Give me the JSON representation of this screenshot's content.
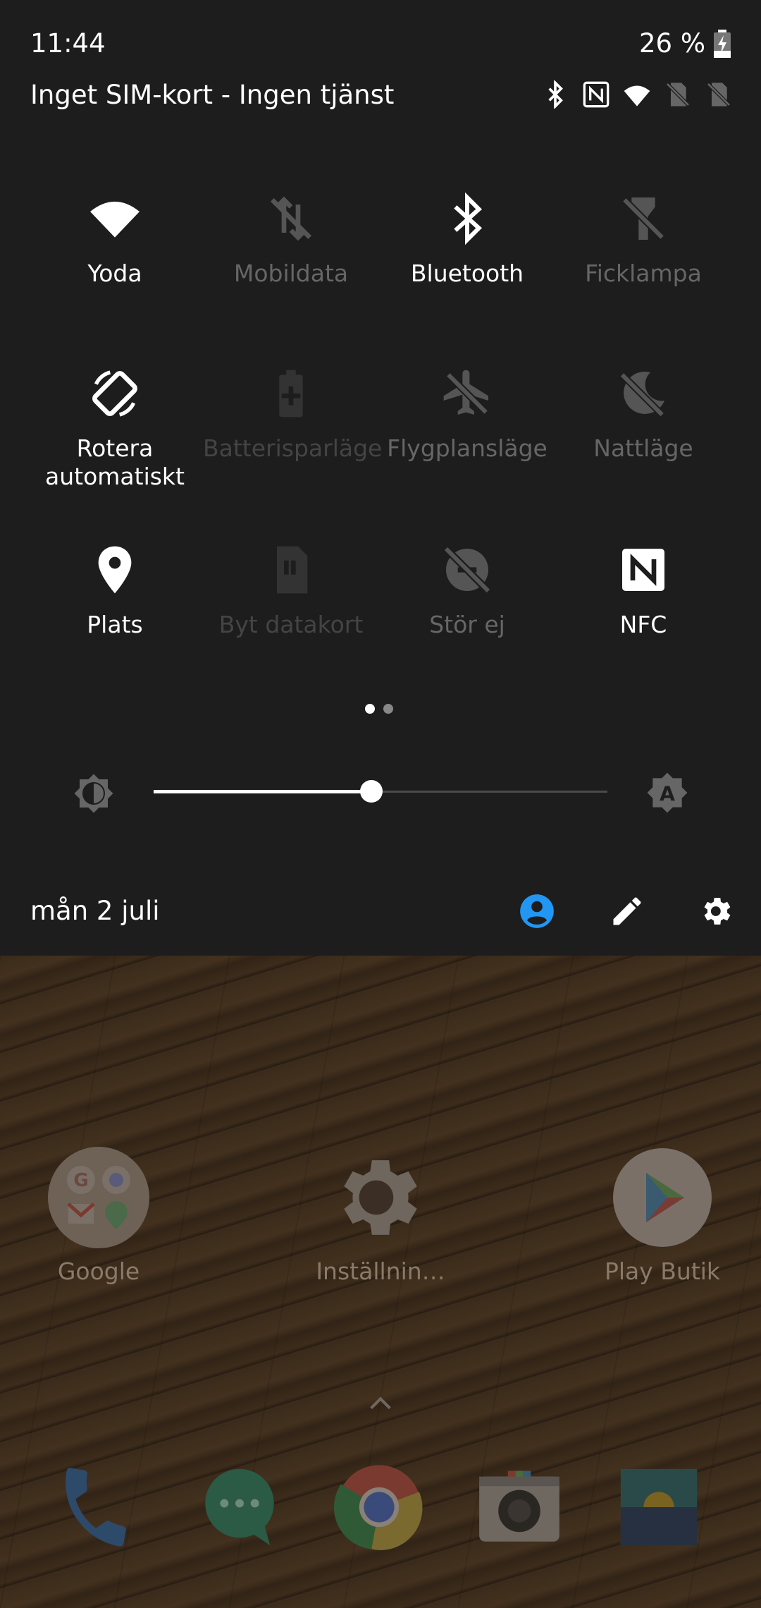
{
  "status_bar": {
    "time": "11:44",
    "battery": "26 %",
    "carrier": "Inget SIM-kort - Ingen tjänst",
    "icons": [
      "bluetooth-icon",
      "nfc-icon",
      "wifi-icon",
      "no-sim-icon",
      "no-sim-icon"
    ]
  },
  "tiles": [
    {
      "label": "Yoda",
      "icon": "wifi-icon",
      "state": "on"
    },
    {
      "label": "Mobildata",
      "icon": "mobile-data-off-icon",
      "state": "off"
    },
    {
      "label": "Bluetooth",
      "icon": "bluetooth-icon",
      "state": "on"
    },
    {
      "label": "Ficklampa",
      "icon": "flashlight-icon",
      "state": "off"
    },
    {
      "label": "Rotera automatiskt",
      "icon": "auto-rotate-icon",
      "state": "on"
    },
    {
      "label": "Batterisparläge",
      "icon": "battery-saver-icon",
      "state": "disabled"
    },
    {
      "label": "Flygplansläge",
      "icon": "airplane-mode-icon",
      "state": "off"
    },
    {
      "label": "Nattläge",
      "icon": "night-mode-icon",
      "state": "off"
    },
    {
      "label": "Plats",
      "icon": "location-icon",
      "state": "on"
    },
    {
      "label": "Byt datakort",
      "icon": "sim-card-icon",
      "state": "disabled"
    },
    {
      "label": "Stör ej",
      "icon": "do-not-disturb-icon",
      "state": "off"
    },
    {
      "label": "NFC",
      "icon": "nfc-icon",
      "state": "on"
    }
  ],
  "page_indicator": {
    "pages": 2,
    "current": 1
  },
  "brightness": {
    "level": 0.48,
    "auto_label": "A"
  },
  "date": "mån 2 juli",
  "colors": {
    "user_accent": "#2196f3",
    "tile_on": "#ffffff",
    "tile_off": "#666666"
  },
  "home": {
    "apps": [
      {
        "label": "Google",
        "icon": "google-folder-icon"
      },
      {
        "label": "Inställnin…",
        "icon": "settings-app-icon"
      },
      {
        "label": "Play Butik",
        "icon": "play-store-icon"
      }
    ],
    "dock": [
      "phone-icon",
      "messages-icon",
      "chrome-icon",
      "camera-icon",
      "gallery-icon"
    ]
  }
}
